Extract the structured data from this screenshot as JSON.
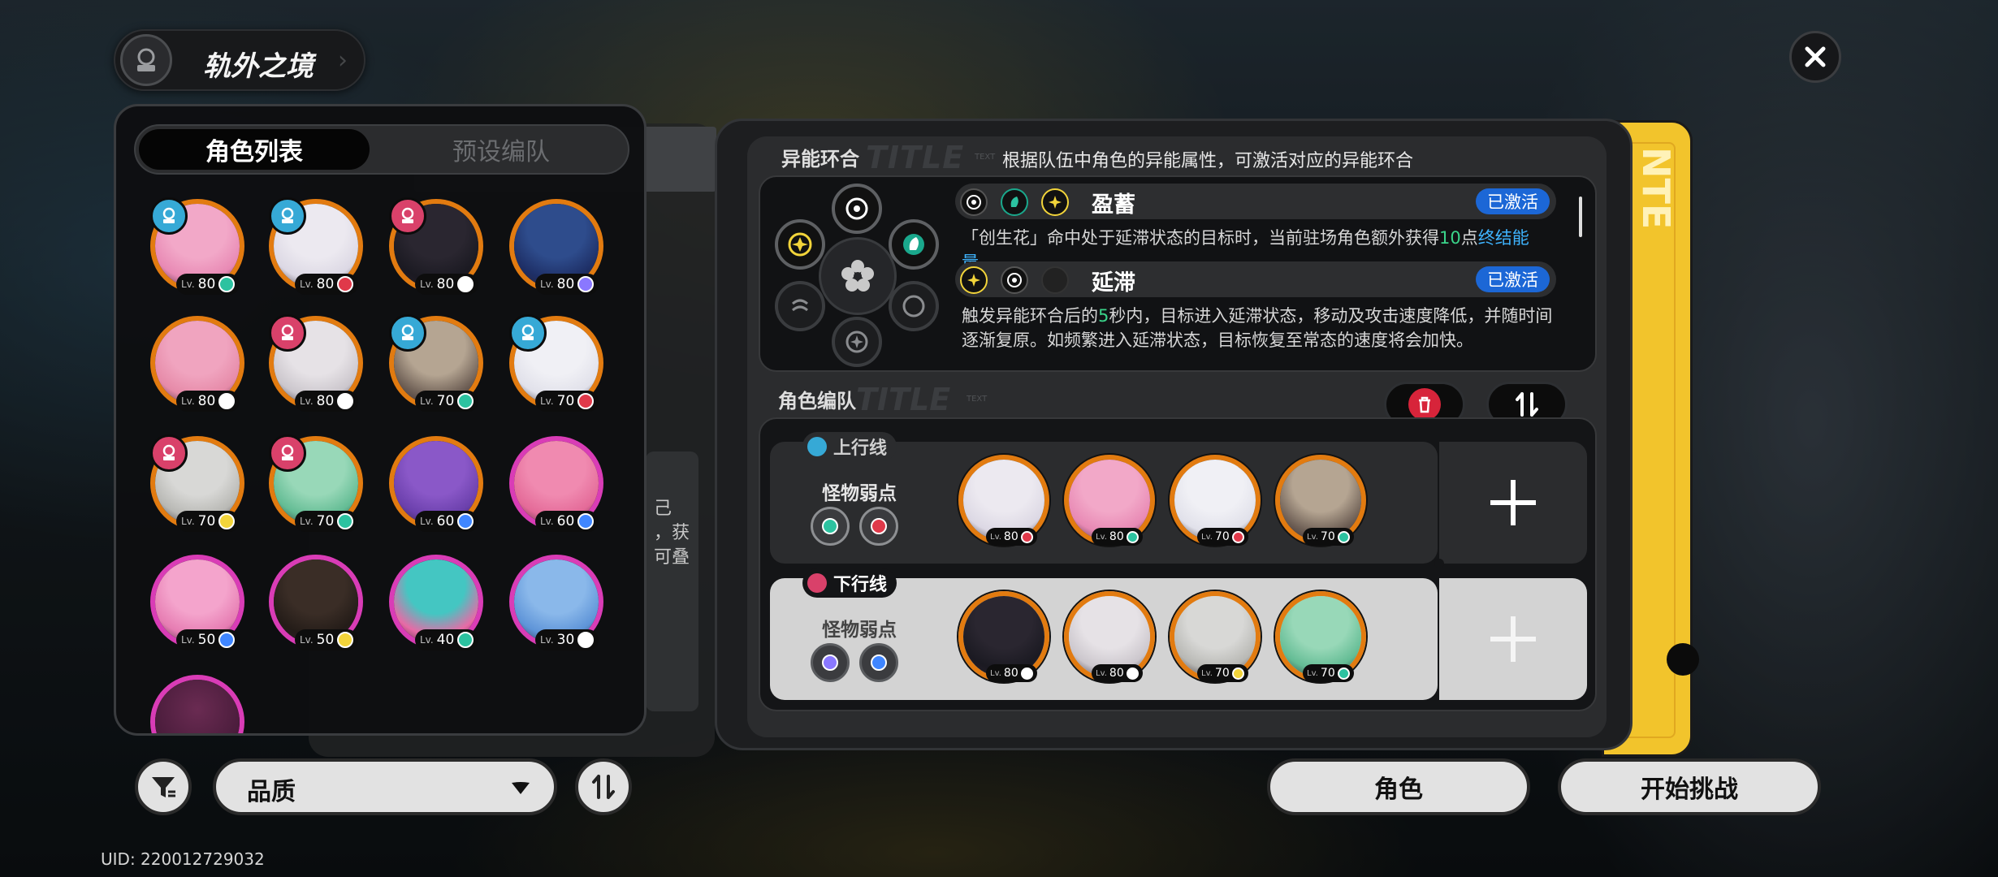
{
  "header": {
    "title": "轨外之境"
  },
  "left_panel": {
    "tabs": [
      "角色列表",
      "预设编队"
    ],
    "characters": [
      {
        "level": "80",
        "el": "#2cc2a0",
        "rank": "b",
        "face": "#f2a8c8",
        "hair": "#e889b4"
      },
      {
        "level": "80",
        "el": "#e0394a",
        "rank": "b",
        "face": "#ece9f0",
        "hair": "#dcd8e4"
      },
      {
        "level": "80",
        "el": "#ffffff",
        "rank": "r",
        "face": "#2a2630",
        "hair": "#1b1a22"
      },
      {
        "level": "80",
        "el": "#8a78ff",
        "rank": "",
        "face": "#2e4c8c",
        "hair": "#1e2f66"
      },
      {
        "level": "80",
        "el": "#ffffff",
        "rank": "",
        "face": "#f0a4bf",
        "hair": "#e68aa8"
      },
      {
        "level": "80",
        "el": "#ffffff",
        "rank": "r",
        "face": "#e6e2e6",
        "hair": "#cbc6cc"
      },
      {
        "level": "70",
        "el": "#2cc2a0",
        "rank": "b",
        "face": "#b5a592",
        "hair": "#6e5f55"
      },
      {
        "level": "70",
        "el": "#e0394a",
        "rank": "b",
        "face": "#f0f0f5",
        "hair": "#e1e1ea"
      },
      {
        "level": "70",
        "el": "#f2d43a",
        "rank": "r",
        "face": "#d8d8d6",
        "hair": "#b8b8b4"
      },
      {
        "level": "70",
        "el": "#2cc2a0",
        "rank": "r",
        "face": "#98d8b8",
        "hair": "#63bc94"
      },
      {
        "level": "60",
        "el": "#3f86ff",
        "rank": "",
        "face": "#8a58c8",
        "hair": "#6b40ac"
      },
      {
        "level": "60",
        "el": "#3f86ff",
        "rank": "",
        "face": "#f08ab0",
        "hair": "#e46a98"
      },
      {
        "level": "50",
        "el": "#3f86ff",
        "rank": "",
        "face": "#f4a4cc",
        "hair": "#e67cb2"
      },
      {
        "level": "50",
        "el": "#f2d43a",
        "rank": "",
        "face": "#3a2d26",
        "hair": "#241c18"
      },
      {
        "level": "40",
        "el": "#2cc2a0",
        "rank": "",
        "face": "#44c6c2",
        "hair": "#e86aa6"
      },
      {
        "level": "30",
        "el": "#ffffff",
        "rank": "",
        "face": "#8ab8ea",
        "hair": "#5e94d8"
      }
    ],
    "sort_select": "品质"
  },
  "uid": "UID: 220012729032",
  "ghost_text": [
    "己",
    "，获",
    "可叠"
  ],
  "resonance": {
    "section_label": "异能环合",
    "deco": "TITLE",
    "tiny": "TEXT",
    "desc": "根据队伍中角色的异能属性，可激活对应的异能环合",
    "items": [
      {
        "name": "盈蓄",
        "status": "已激活",
        "text_before": "「创生花」命中处于延滞状态的目标时，当前驻场角色额外获得",
        "highlight_num": "10",
        "text_mid": "点",
        "highlight_term": "终结能量",
        "text_after": "。"
      },
      {
        "name": "延滞",
        "status": "已激活",
        "text_before": "触发异能环合后的",
        "highlight_num": "5",
        "text_after": "秒内，目标进入延滞状态，移动及攻击速度降低，并随时间逐渐复原。如频繁进入延滞状态，目标恢复至常态的速度将会加快。"
      }
    ]
  },
  "team": {
    "section_label": "角色编队",
    "deco": "TITLE",
    "tiny": "TEXT",
    "up_line": {
      "label": "上行线",
      "weak_label": "怪物弱点",
      "weak_colors": [
        "#2cc2a0",
        "#e0394a"
      ],
      "members": [
        {
          "level": "80",
          "el": "#e0394a",
          "face": "#ece9f0",
          "hair": "#dcd8e4"
        },
        {
          "level": "80",
          "el": "#2cc2a0",
          "face": "#f2a8c8",
          "hair": "#e889b4"
        },
        {
          "level": "70",
          "el": "#e0394a",
          "face": "#f0f0f5",
          "hair": "#e1e1ea"
        },
        {
          "level": "70",
          "el": "#2cc2a0",
          "face": "#b5a592",
          "hair": "#6e5f55"
        }
      ]
    },
    "down_line": {
      "label": "下行线",
      "weak_label": "怪物弱点",
      "weak_colors": [
        "#8a78ff",
        "#3f86ff"
      ],
      "members": [
        {
          "level": "80",
          "el": "#ffffff",
          "face": "#2a2630",
          "hair": "#1b1a22"
        },
        {
          "level": "80",
          "el": "#ffffff",
          "face": "#e6e2e6",
          "hair": "#cbc6cc"
        },
        {
          "level": "70",
          "el": "#f2d43a",
          "face": "#d8d8d6",
          "hair": "#b8b8b4"
        },
        {
          "level": "70",
          "el": "#2cc2a0",
          "face": "#98d8b8",
          "hair": "#63bc94"
        }
      ]
    }
  },
  "side_text": "NTE",
  "footer": {
    "character_button": "角色",
    "start_button": "开始挑战"
  }
}
